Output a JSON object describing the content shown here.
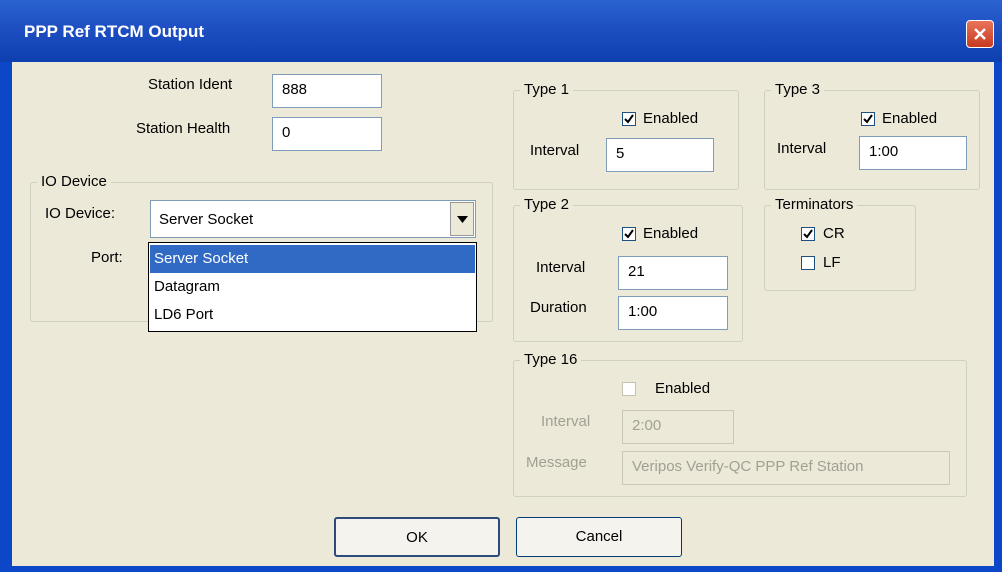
{
  "window": {
    "title": "PPP Ref RTCM Output"
  },
  "station": {
    "ident_label": "Station Ident",
    "ident_value": "888",
    "health_label": "Station Health",
    "health_value": "0"
  },
  "io_device": {
    "group_title": "IO Device",
    "device_label": "IO Device:",
    "device_value": "Server Socket",
    "port_label": "Port:",
    "options": [
      "Server Socket",
      "Datagram",
      "LD6 Port"
    ]
  },
  "type1": {
    "title": "Type 1",
    "enabled_label": "Enabled",
    "enabled": true,
    "interval_label": "Interval",
    "interval_value": "5"
  },
  "type3": {
    "title": "Type 3",
    "enabled_label": "Enabled",
    "enabled": true,
    "interval_label": "Interval",
    "interval_value": "1:00"
  },
  "type2": {
    "title": "Type 2",
    "enabled_label": "Enabled",
    "enabled": true,
    "interval_label": "Interval",
    "interval_value": "21",
    "duration_label": "Duration",
    "duration_value": "1:00"
  },
  "terminators": {
    "title": "Terminators",
    "cr_label": "CR",
    "cr_checked": true,
    "lf_label": "LF",
    "lf_checked": false
  },
  "type16": {
    "title": "Type 16",
    "enabled_label": "Enabled",
    "enabled": false,
    "interval_label": "Interval",
    "interval_value": "2:00",
    "message_label": "Message",
    "message_value": "Veripos Verify-QC PPP Ref Station"
  },
  "buttons": {
    "ok": "OK",
    "cancel": "Cancel"
  },
  "icons": {
    "close": "close-icon",
    "check": "checkmark-icon",
    "dropdown": "chevron-down-icon"
  }
}
